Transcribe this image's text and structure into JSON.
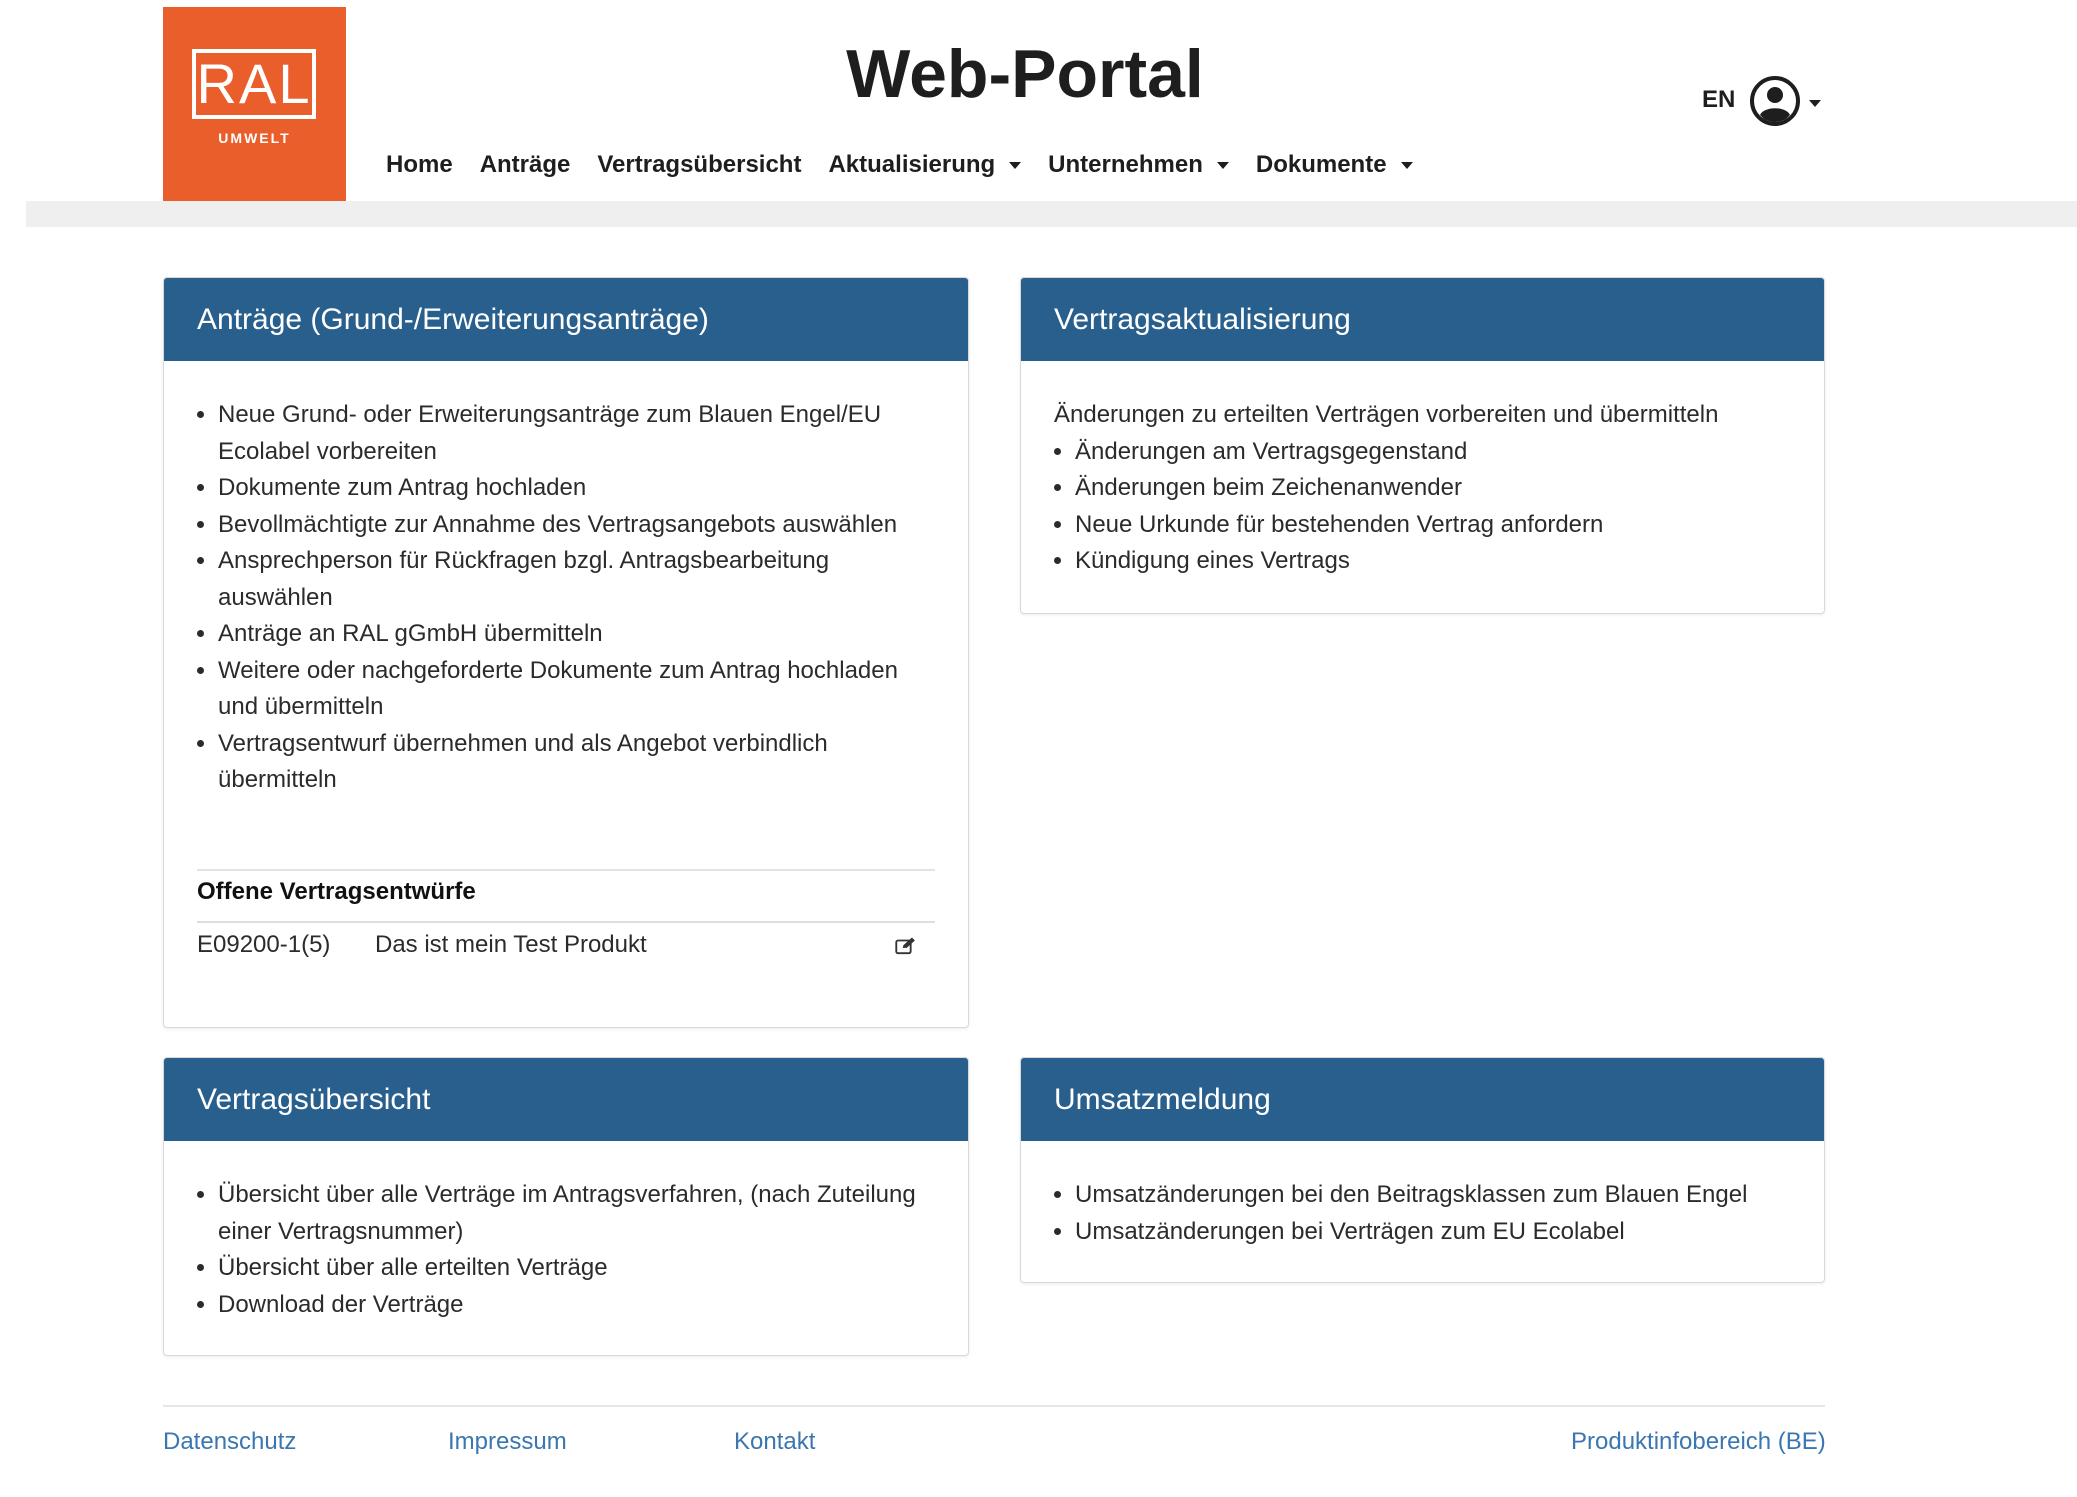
{
  "header": {
    "logo_text": "RAL",
    "logo_subtext": "UMWELT",
    "title": "Web-Portal",
    "language": "EN",
    "nav": [
      {
        "label": "Home",
        "dropdown": false
      },
      {
        "label": "Anträge",
        "dropdown": false
      },
      {
        "label": "Vertragsübersicht",
        "dropdown": false
      },
      {
        "label": "Aktualisierung",
        "dropdown": true
      },
      {
        "label": "Unternehmen",
        "dropdown": true
      },
      {
        "label": "Dokumente",
        "dropdown": true
      }
    ]
  },
  "cards": {
    "antraege": {
      "title": "Anträge (Grund-/Erweiterungsanträge)",
      "items": [
        "Neue Grund- oder Erweiterungsanträge zum Blauen Engel/EU Ecolabel vorbereiten",
        "Dokumente zum Antrag hochladen",
        "Bevollmächtigte zur Annahme des Vertragsangebots auswählen",
        "Ansprechperson für Rückfragen bzgl. Antragsbearbeitung auswählen",
        "Anträge an RAL gGmbH übermitteln",
        "Weitere oder nachgeforderte Dokumente zum Antrag hochladen und übermitteln",
        "Vertragsentwurf übernehmen und als Angebot verbindlich übermitteln"
      ],
      "drafts_title": "Offene Vertragsentwürfe",
      "drafts": [
        {
          "id": "E09200-1(5)",
          "name": "Das ist mein Test Produkt"
        }
      ]
    },
    "aktualisierung": {
      "title": "Vertragsaktualisierung",
      "intro": "Änderungen zu erteilten Verträgen vorbereiten und übermitteln",
      "items": [
        "Änderungen am Vertragsgegenstand",
        "Änderungen beim Zeichenanwender",
        "Neue Urkunde für bestehenden Vertrag anfordern",
        "Kündigung eines Vertrags"
      ]
    },
    "uebersicht": {
      "title": "Vertragsübersicht",
      "items": [
        "Übersicht über alle Verträge im Antragsverfahren, (nach Zuteilung einer Vertragsnummer)",
        "Übersicht über alle erteilten Verträge",
        "Download der Verträge"
      ]
    },
    "umsatz": {
      "title": "Umsatzmeldung",
      "items": [
        "Umsatzänderungen bei den Beitragsklassen zum Blauen Engel",
        "Umsatzänderungen bei Verträgen zum EU Ecolabel"
      ]
    }
  },
  "footer": {
    "links": [
      "Datenschutz",
      "Impressum",
      "Kontakt",
      "Produktinfobereich (BE)"
    ]
  },
  "colors": {
    "brand_orange": "#e95e2b",
    "card_header_blue": "#295f8c",
    "link_blue": "#3a76b0"
  },
  "icons": {
    "user": "user-circle-icon",
    "edit": "edit-icon"
  }
}
